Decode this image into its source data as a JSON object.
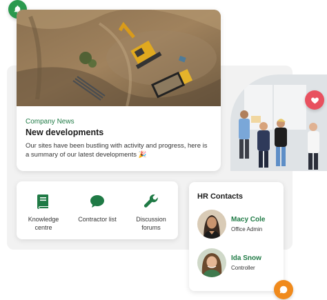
{
  "colors": {
    "brand_green": "#1f7a45",
    "notification_green": "#2b9a4f",
    "favorite_red": "#e8515f",
    "chat_orange": "#f08a1c"
  },
  "news": {
    "tag": "Company News",
    "title": "New developments",
    "body": "Our sites have been bustling with activity and progress, here is a summary of our latest developments 🎉",
    "image_alt": "Aerial view of construction site with excavator and dump truck"
  },
  "meeting_photo_alt": "Team meeting at whiteboard",
  "floating_buttons": {
    "bell_icon": "bell-icon",
    "heart_icon": "heart-icon",
    "chat_icon": "chat-bubble-icon"
  },
  "quick_links": [
    {
      "label": "Knowledge centre",
      "icon": "book-icon"
    },
    {
      "label": "Contractor list",
      "icon": "speech-bubble-icon"
    },
    {
      "label": "Discussion forums",
      "icon": "wrench-icon"
    }
  ],
  "hr": {
    "title": "HR Contacts",
    "contacts": [
      {
        "name": "Macy Cole",
        "role": "Office Admin"
      },
      {
        "name": "Ida Snow",
        "role": "Controller"
      }
    ]
  }
}
